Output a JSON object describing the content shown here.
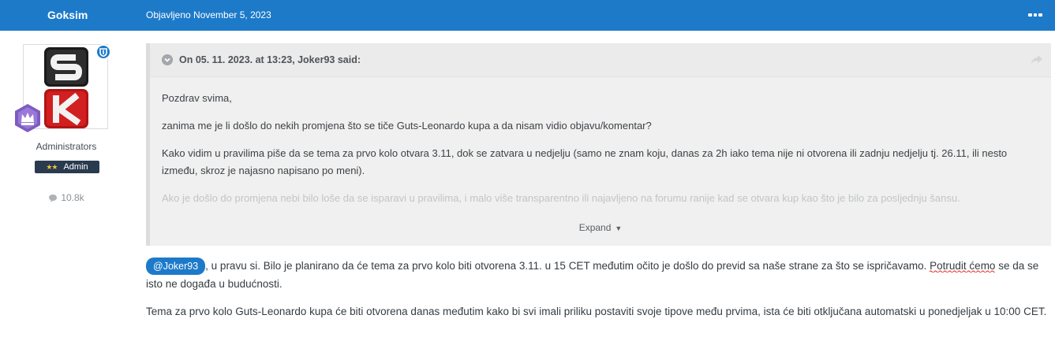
{
  "post": {
    "author": "Goksim",
    "posted_date": "Objavljeno November 5, 2023"
  },
  "user": {
    "group": "Administrators",
    "badge": "Admin",
    "badge_stars": "★★",
    "post_count": "10.8k"
  },
  "quote": {
    "citation": "On 05. 11. 2023. at 13:23, Joker93 said:",
    "paragraphs": [
      "Pozdrav svima,",
      "zanima me je li došlo do nekih promjena što se tiče Guts-Leonardo kupa a da nisam vidio objavu/komentar?",
      "Kako vidim u pravilima piše da se tema za prvo kolo otvara 3.11, dok se zatvara u nedjelju (samo ne znam koju, danas za 2h iako tema nije ni otvorena ili zadnju nedjelju tj. 26.11, ili nesto između, skroz je najasno napisano po meni).",
      "Ako je došlo do promjena nebi bilo loše da se isparavi u pravilima, i malo više transparentno ili najavljeno na forumu ranije kad se otvara kup kao što je bilo za posljednju šansu."
    ],
    "expand_label": "Expand"
  },
  "reply": {
    "mention": "@Joker93",
    "p1_a": ", u pravu si. Bilo je planirano da će tema za prvo kolo biti otvorena 3.11. u 15 CET međutim očito je došlo do previd sa naše strane za što se ispričavamo. ",
    "p1_underlined": "Potrudit ćemo",
    "p1_b": " se da se isto ne događa u budućnosti.",
    "p2": "Tema za prvo kolo Guts-Leonardo kupa će biti otvorena danas međutim kako bi svi imali priliku postaviti svoje tipove među prvima, ista će biti otključana automatski u ponedjeljak u 10:00 CET."
  },
  "colors": {
    "accent": "#1d7ac9",
    "badge_bg": "#2a3b4f",
    "quote_bg": "#f0f0f0",
    "spell_underline": "#e02020"
  },
  "icons": [
    "more-icon",
    "shield-icon",
    "rank-crown-icon",
    "comment-icon",
    "chevron-down-icon",
    "share-icon",
    "caret-down-icon"
  ]
}
